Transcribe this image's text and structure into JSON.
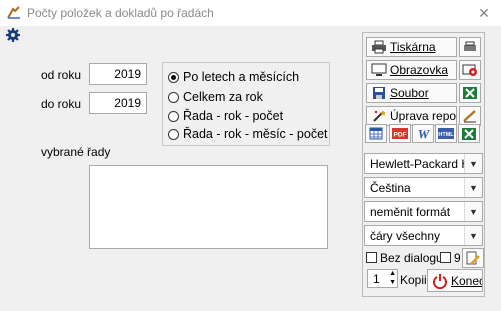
{
  "window": {
    "title": "Počty položek a dokladů po řadách",
    "close_symbol": "✕"
  },
  "form": {
    "from_year_label": "od roku",
    "from_year_value": "2019",
    "to_year_label": "do roku",
    "to_year_value": "2019",
    "series_label": "vybrané řady",
    "series_value": ""
  },
  "options": [
    {
      "label": "Po letech a měsících",
      "selected": true
    },
    {
      "label": "Celkem za rok",
      "selected": false
    },
    {
      "label": "Řada - rok - počet",
      "selected": false
    },
    {
      "label": "Řada - rok - měsíc - počet",
      "selected": false
    }
  ],
  "output": {
    "printer": "Tiskárna",
    "screen": "Obrazovka",
    "file": "Soubor",
    "edit_report": "Úprava repor",
    "printer_select": "Hewlett-Packard HP",
    "language_select": "Čeština",
    "format_select": "neměnit formát",
    "lines_select": "čáry všechny",
    "no_dialog_label": "Bez dialogu",
    "nine_label": "9",
    "copies_value": "1",
    "copies_label": "Kopii",
    "end_button": "Konec"
  },
  "colors": {
    "excel_green": "#1e7b3a",
    "pdf_red": "#d9352b",
    "word_blue": "#2b5aa8",
    "power_red": "#d21f1f"
  }
}
